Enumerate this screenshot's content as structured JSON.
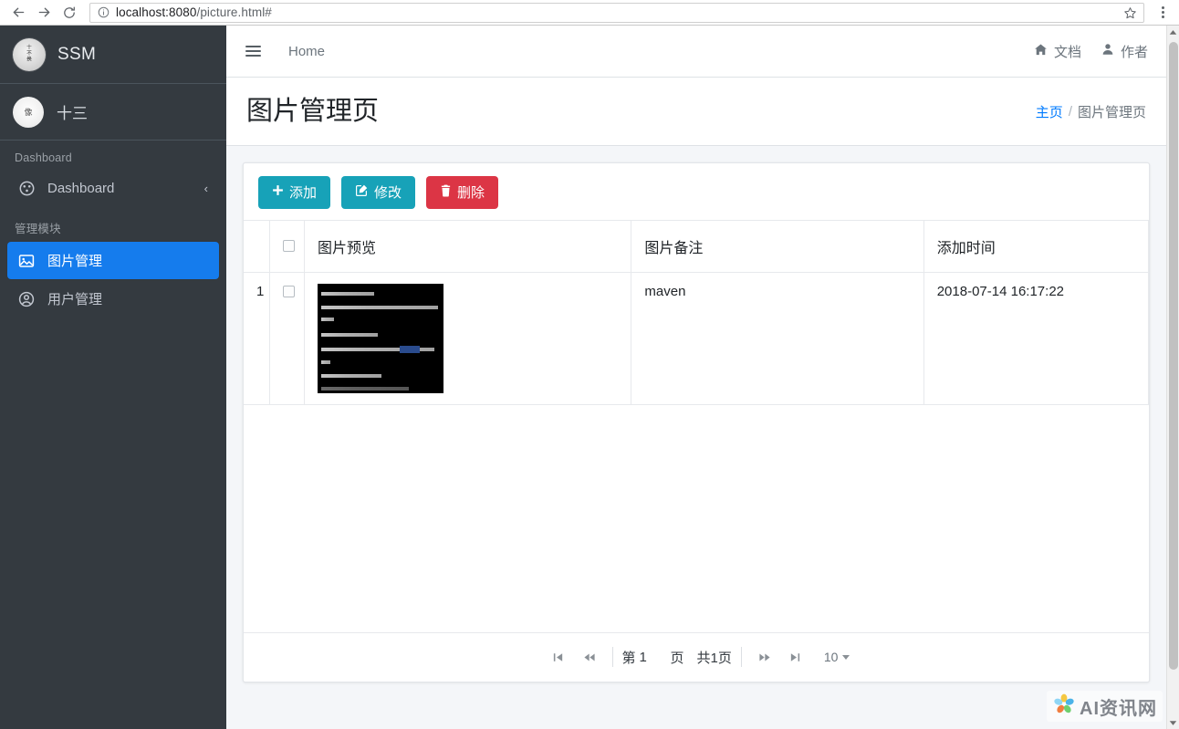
{
  "browser": {
    "url_host": "localhost:8080",
    "url_path": "/picture.html#",
    "back_icon": "back-arrow-icon",
    "forward_icon": "forward-arrow-icon",
    "reload_icon": "reload-icon",
    "info_icon": "info-circle-icon",
    "star_icon": "bookmark-star-icon",
    "menu_icon": "browser-menu-icon"
  },
  "sidebar": {
    "brand": {
      "logo_text": "十\n不\n换",
      "name": "SSM"
    },
    "user": {
      "avatar_text": "像",
      "name": "十三"
    },
    "sections": [
      {
        "header": "Dashboard",
        "items": [
          {
            "label": "Dashboard",
            "icon": "tachometer-icon",
            "active": false,
            "chevron": "‹"
          }
        ]
      },
      {
        "header": "管理模块",
        "items": [
          {
            "label": "图片管理",
            "icon": "image-icon",
            "active": true,
            "chevron": ""
          },
          {
            "label": "用户管理",
            "icon": "user-circle-icon",
            "active": false,
            "chevron": ""
          }
        ]
      }
    ]
  },
  "navbar": {
    "menu_icon": "hamburger-icon",
    "home_label": "Home",
    "right_links": [
      {
        "label": "文档",
        "icon": "home-icon"
      },
      {
        "label": "作者",
        "icon": "user-icon"
      }
    ]
  },
  "content_header": {
    "title": "图片管理页",
    "breadcrumb": {
      "home": "主页",
      "separator": "/",
      "current": "图片管理页"
    }
  },
  "toolbar": {
    "add_label": "添加",
    "add_icon": "plus-icon",
    "edit_label": "修改",
    "edit_icon": "pencil-square-icon",
    "delete_label": "删除",
    "delete_icon": "trash-icon"
  },
  "table": {
    "columns": [
      "",
      "",
      "图片预览",
      "图片备注",
      "添加时间"
    ],
    "select_all_checkbox": "select-all-checkbox",
    "rows": [
      {
        "index": "1",
        "checked": false,
        "preview_alt": "console-screenshot-thumbnail",
        "note": "maven",
        "time": "2018-07-14 16:17:22"
      }
    ]
  },
  "pagination": {
    "first_icon": "first-page-icon",
    "prev_icon": "prev-page-icon",
    "next_icon": "next-page-icon",
    "last_icon": "last-page-icon",
    "page_prefix": "第",
    "page_value": "1",
    "page_suffix": "页",
    "total_pages": "共1页",
    "page_size": "10"
  },
  "watermark": {
    "text": "AI资讯网",
    "logo_icon": "pinwheel-logo-icon"
  },
  "colors": {
    "sidebar_bg": "#343a40",
    "active_nav": "#157ced",
    "btn_teal": "#17a2b8",
    "btn_red": "#dc3545",
    "link_blue": "#007bff",
    "content_bg": "#f4f6f9"
  }
}
